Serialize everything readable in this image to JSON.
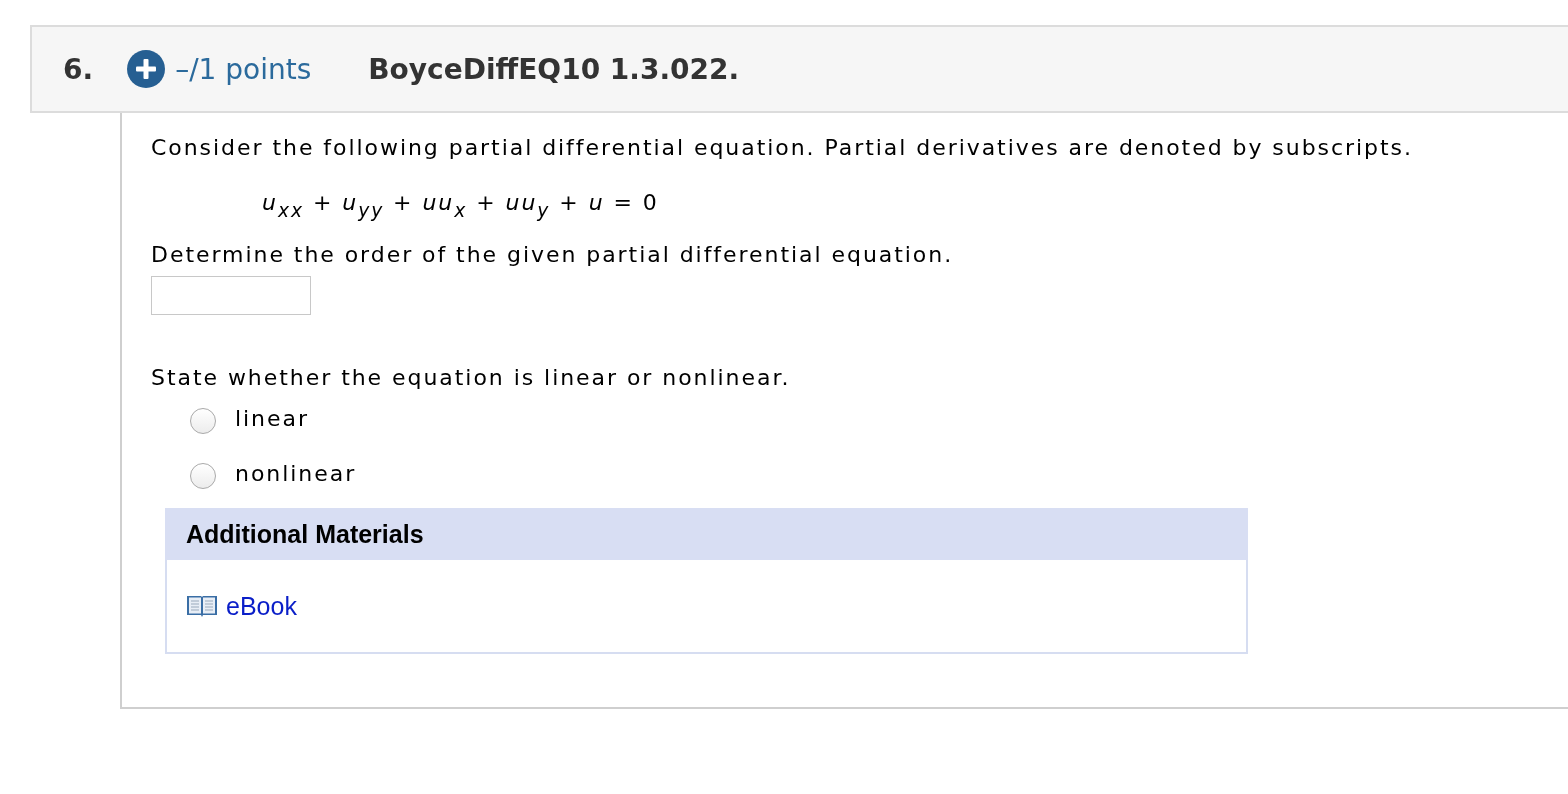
{
  "question": {
    "number": "6.",
    "points": "–/1 points",
    "title": "BoyceDiffEQ10 1.3.022."
  },
  "intro": "Consider the following partial differential equation. Partial derivatives are denoted by subscripts.",
  "equation": "*u*$_{xx}$ + *u*$_{yy}$ + *uu*$_{x}$ + *uu*$_{y}$ + *u* = 0",
  "parts": [
    {
      "kind": "blank",
      "prompt": "Determine the order of the given partial differential equation."
    },
    {
      "kind": "choice",
      "prompt": "State whether the equation is linear or nonlinear.",
      "options": [
        {
          "label": "linear",
          "selected": false
        },
        {
          "label": "nonlinear",
          "selected": false
        }
      ]
    }
  ],
  "additional_materials": {
    "title": "Additional Materials",
    "links": [
      {
        "label": "eBook"
      }
    ]
  }
}
